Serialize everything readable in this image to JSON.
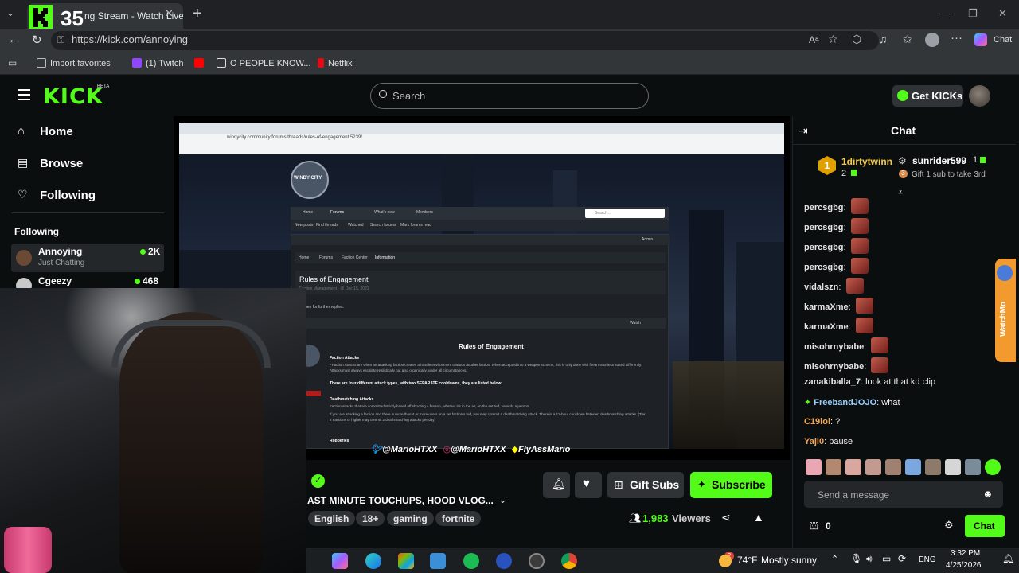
{
  "browser": {
    "tab_title": "ng Stream - Watch Live",
    "close_glyph": "✕",
    "new_tab_glyph": "+",
    "url": "https://kick.com/annoying",
    "toolbar_chat_label": "Chat",
    "bookmarks": [
      {
        "label": "Import favorites",
        "color": "#bbbbbb"
      },
      {
        "label": "(1) Twitch",
        "color": "#9146ff"
      },
      {
        "label": "",
        "color": "#ff0000"
      },
      {
        "label": "O PEOPLE KNOW...",
        "color": "#dddddd"
      },
      {
        "label": "Netflix",
        "color": "#e50914"
      }
    ]
  },
  "overlay_badge": {
    "number": "35"
  },
  "kick": {
    "logo": "KICK",
    "logo_sup": "BETA",
    "search_placeholder": "Search",
    "get_kicks_label": "Get KICKs",
    "nav": [
      {
        "label": "Home",
        "icon": "home-icon"
      },
      {
        "label": "Browse",
        "icon": "browse-icon"
      },
      {
        "label": "Following",
        "icon": "heart-icon"
      }
    ],
    "following_heading": "Following",
    "following": [
      {
        "name": "Annoying",
        "category": "Just Chatting",
        "viewers": "2K"
      },
      {
        "name": "Cgeezy",
        "category": "",
        "viewers": "468"
      }
    ],
    "stream": {
      "title": "AST MINUTE TOUCHUPS, HOOD VLOG...",
      "tags": [
        "English",
        "18+",
        "gaming",
        "fortnite"
      ],
      "viewers": "1,983",
      "viewers_label": "Viewers",
      "gift_subs_label": "Gift Subs",
      "subscribe_label": "Subscribe",
      "socials": [
        "@MarioHTXX",
        "@MarioHTXX",
        "FlyAssMario"
      ]
    },
    "embedded_page": {
      "url": "windycity.community/forums/threads/rules-of-engagement.5239/",
      "logo_text": "WINDY CITY",
      "nav": [
        "Home",
        "Forums",
        "What's new",
        "Members"
      ],
      "subnav": [
        "New posts",
        "Find threads",
        "Watched",
        "Search forums",
        "Mark forums read"
      ],
      "breadcrumb": [
        "Home",
        "Forums",
        "Faction Center",
        "Information"
      ],
      "thread_title": "Rules of Engagement",
      "thread_meta": "Faction Management · @ Dec 15, 2022",
      "notice": "Not open for further replies.",
      "post_title": "Rules of Engagement",
      "section1": "Faction Attacks",
      "para1": "• Faction Attacks are when an attacking faction creates a hostile environment towards another faction. When accepted into a weapon scheme, this is only done with firearms unless stated differently. Attacks must always escalate realistically but also organically, under all circumstances.",
      "highlight": "There are four different attack types, with two SEPARATE cooldowns, they are listed below:",
      "section2": "Deathmatching Attacks",
      "para2": "Faction attacks that are committed strictly based off shooting a firearm, whether it's in the air, on the set turf, towards a person.",
      "para3": "If you are attacking a faction and there is more than 4 or more users on a set faction's turf, you may commit a deathmatching attack. There is a 12-hour cooldown between deathmatching attacks. (Tier 2 Factions or higher may commit 2 deathmatching attacks per day)",
      "section3": "Robberies",
      "watch_label": "Watch",
      "admin_label": "Admin",
      "search_label": "Search..."
    },
    "chat": {
      "header": "Chat",
      "leaderboard": [
        {
          "rank": "1",
          "name": "1dirtytwinn",
          "count": "2"
        },
        {
          "rank": "",
          "name": "sunrider599",
          "count": "1"
        }
      ],
      "gift_prompt": "Gift 1 sub to take 3rd",
      "messages": [
        {
          "user": "percsgbg",
          "text": "",
          "color": "#e6e6e6",
          "emote": true
        },
        {
          "user": "percsgbg",
          "text": "",
          "color": "#e6e6e6",
          "emote": true
        },
        {
          "user": "percsgbg",
          "text": "",
          "color": "#e6e6e6",
          "emote": true
        },
        {
          "user": "percsgbg",
          "text": "",
          "color": "#e6e6e6",
          "emote": true
        },
        {
          "user": "vidalszn",
          "text": "",
          "color": "#e6e6e6",
          "emote": true
        },
        {
          "user": "karmaXme",
          "text": "",
          "color": "#e6e6e6",
          "emote": true
        },
        {
          "user": "karmaXme",
          "text": "",
          "color": "#e6e6e6",
          "emote": true
        },
        {
          "user": "misohrnybabe",
          "text": "",
          "color": "#e6e6e6",
          "emote": true
        },
        {
          "user": "misohrnybabe",
          "text": "",
          "color": "#e6e6e6",
          "emote": true
        },
        {
          "user": "zanakiballa_7",
          "text": "look at that kd clip",
          "color": "#e6e6e6",
          "emote": false
        },
        {
          "user": "FreebandJOJO",
          "text": "what",
          "color": "#9ad0ff",
          "emote": false
        },
        {
          "user": "C19lol",
          "text": "?",
          "color": "#f2a65a",
          "emote": false
        },
        {
          "user": "Yaji0",
          "text": "pause",
          "color": "#f2a65a",
          "emote": false
        }
      ],
      "input_placeholder": "Send a message",
      "points": "0",
      "send_label": "Chat"
    }
  },
  "taskbar": {
    "weather_badge": "2",
    "temperature": "74°F",
    "weather": "Mostly sunny",
    "language": "ENG",
    "time": "3:32 PM",
    "date": "4/25/2026"
  },
  "side_widget": {
    "label": "WatchMo"
  }
}
